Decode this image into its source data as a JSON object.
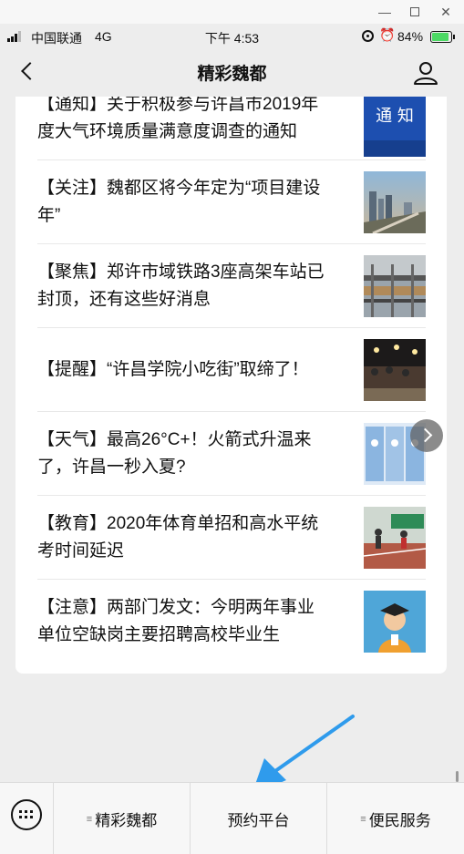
{
  "status_bar": {
    "carrier": "中国联通",
    "network": "4G",
    "time": "下午 4:53",
    "battery": "84%",
    "battery_level": 0.84
  },
  "nav": {
    "title": "精彩魏都"
  },
  "articles": [
    {
      "title": "【通知】关于积极参与许昌市2019年度大气环境质量满意度调查的通知",
      "thumb_text": "通 知"
    },
    {
      "title": "【关注】魏都区将今年定为“项目建设年”"
    },
    {
      "title": "【聚焦】郑许市域铁路3座高架车站已封顶，还有这些好消息"
    },
    {
      "title": "【提醒】“许昌学院小吃街”取缔了！"
    },
    {
      "title": "【天气】最高26°C+！火箭式升温来了，许昌一秒入夏?"
    },
    {
      "title": "【教育】2020年体育单招和高水平统考时间延迟"
    },
    {
      "title": "【注意】两部门发文：今明两年事业单位空缺岗主要招聘高校毕业生"
    }
  ],
  "menu": [
    {
      "label": "精彩魏都"
    },
    {
      "label": "预约平台"
    },
    {
      "label": "便民服务"
    }
  ],
  "colors": {
    "accent_arrow": "#2f9bec",
    "notice_blue": "#1d4fb0"
  }
}
